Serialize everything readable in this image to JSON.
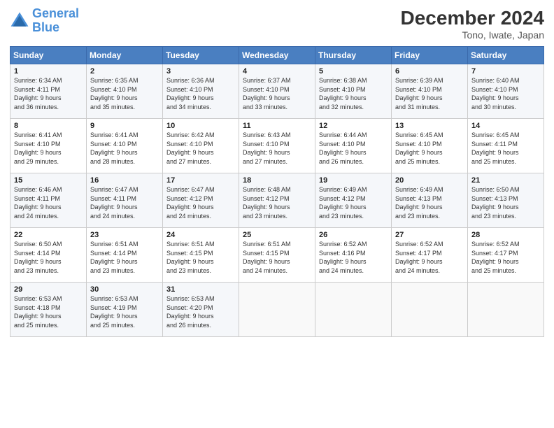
{
  "header": {
    "logo_line1": "General",
    "logo_line2": "Blue",
    "month": "December 2024",
    "location": "Tono, Iwate, Japan"
  },
  "weekdays": [
    "Sunday",
    "Monday",
    "Tuesday",
    "Wednesday",
    "Thursday",
    "Friday",
    "Saturday"
  ],
  "weeks": [
    [
      {
        "day": "1",
        "lines": [
          "Sunrise: 6:34 AM",
          "Sunset: 4:11 PM",
          "Daylight: 9 hours",
          "and 36 minutes."
        ]
      },
      {
        "day": "2",
        "lines": [
          "Sunrise: 6:35 AM",
          "Sunset: 4:10 PM",
          "Daylight: 9 hours",
          "and 35 minutes."
        ]
      },
      {
        "day": "3",
        "lines": [
          "Sunrise: 6:36 AM",
          "Sunset: 4:10 PM",
          "Daylight: 9 hours",
          "and 34 minutes."
        ]
      },
      {
        "day": "4",
        "lines": [
          "Sunrise: 6:37 AM",
          "Sunset: 4:10 PM",
          "Daylight: 9 hours",
          "and 33 minutes."
        ]
      },
      {
        "day": "5",
        "lines": [
          "Sunrise: 6:38 AM",
          "Sunset: 4:10 PM",
          "Daylight: 9 hours",
          "and 32 minutes."
        ]
      },
      {
        "day": "6",
        "lines": [
          "Sunrise: 6:39 AM",
          "Sunset: 4:10 PM",
          "Daylight: 9 hours",
          "and 31 minutes."
        ]
      },
      {
        "day": "7",
        "lines": [
          "Sunrise: 6:40 AM",
          "Sunset: 4:10 PM",
          "Daylight: 9 hours",
          "and 30 minutes."
        ]
      }
    ],
    [
      {
        "day": "8",
        "lines": [
          "Sunrise: 6:41 AM",
          "Sunset: 4:10 PM",
          "Daylight: 9 hours",
          "and 29 minutes."
        ]
      },
      {
        "day": "9",
        "lines": [
          "Sunrise: 6:41 AM",
          "Sunset: 4:10 PM",
          "Daylight: 9 hours",
          "and 28 minutes."
        ]
      },
      {
        "day": "10",
        "lines": [
          "Sunrise: 6:42 AM",
          "Sunset: 4:10 PM",
          "Daylight: 9 hours",
          "and 27 minutes."
        ]
      },
      {
        "day": "11",
        "lines": [
          "Sunrise: 6:43 AM",
          "Sunset: 4:10 PM",
          "Daylight: 9 hours",
          "and 27 minutes."
        ]
      },
      {
        "day": "12",
        "lines": [
          "Sunrise: 6:44 AM",
          "Sunset: 4:10 PM",
          "Daylight: 9 hours",
          "and 26 minutes."
        ]
      },
      {
        "day": "13",
        "lines": [
          "Sunrise: 6:45 AM",
          "Sunset: 4:10 PM",
          "Daylight: 9 hours",
          "and 25 minutes."
        ]
      },
      {
        "day": "14",
        "lines": [
          "Sunrise: 6:45 AM",
          "Sunset: 4:11 PM",
          "Daylight: 9 hours",
          "and 25 minutes."
        ]
      }
    ],
    [
      {
        "day": "15",
        "lines": [
          "Sunrise: 6:46 AM",
          "Sunset: 4:11 PM",
          "Daylight: 9 hours",
          "and 24 minutes."
        ]
      },
      {
        "day": "16",
        "lines": [
          "Sunrise: 6:47 AM",
          "Sunset: 4:11 PM",
          "Daylight: 9 hours",
          "and 24 minutes."
        ]
      },
      {
        "day": "17",
        "lines": [
          "Sunrise: 6:47 AM",
          "Sunset: 4:12 PM",
          "Daylight: 9 hours",
          "and 24 minutes."
        ]
      },
      {
        "day": "18",
        "lines": [
          "Sunrise: 6:48 AM",
          "Sunset: 4:12 PM",
          "Daylight: 9 hours",
          "and 23 minutes."
        ]
      },
      {
        "day": "19",
        "lines": [
          "Sunrise: 6:49 AM",
          "Sunset: 4:12 PM",
          "Daylight: 9 hours",
          "and 23 minutes."
        ]
      },
      {
        "day": "20",
        "lines": [
          "Sunrise: 6:49 AM",
          "Sunset: 4:13 PM",
          "Daylight: 9 hours",
          "and 23 minutes."
        ]
      },
      {
        "day": "21",
        "lines": [
          "Sunrise: 6:50 AM",
          "Sunset: 4:13 PM",
          "Daylight: 9 hours",
          "and 23 minutes."
        ]
      }
    ],
    [
      {
        "day": "22",
        "lines": [
          "Sunrise: 6:50 AM",
          "Sunset: 4:14 PM",
          "Daylight: 9 hours",
          "and 23 minutes."
        ]
      },
      {
        "day": "23",
        "lines": [
          "Sunrise: 6:51 AM",
          "Sunset: 4:14 PM",
          "Daylight: 9 hours",
          "and 23 minutes."
        ]
      },
      {
        "day": "24",
        "lines": [
          "Sunrise: 6:51 AM",
          "Sunset: 4:15 PM",
          "Daylight: 9 hours",
          "and 23 minutes."
        ]
      },
      {
        "day": "25",
        "lines": [
          "Sunrise: 6:51 AM",
          "Sunset: 4:15 PM",
          "Daylight: 9 hours",
          "and 24 minutes."
        ]
      },
      {
        "day": "26",
        "lines": [
          "Sunrise: 6:52 AM",
          "Sunset: 4:16 PM",
          "Daylight: 9 hours",
          "and 24 minutes."
        ]
      },
      {
        "day": "27",
        "lines": [
          "Sunrise: 6:52 AM",
          "Sunset: 4:17 PM",
          "Daylight: 9 hours",
          "and 24 minutes."
        ]
      },
      {
        "day": "28",
        "lines": [
          "Sunrise: 6:52 AM",
          "Sunset: 4:17 PM",
          "Daylight: 9 hours",
          "and 25 minutes."
        ]
      }
    ],
    [
      {
        "day": "29",
        "lines": [
          "Sunrise: 6:53 AM",
          "Sunset: 4:18 PM",
          "Daylight: 9 hours",
          "and 25 minutes."
        ]
      },
      {
        "day": "30",
        "lines": [
          "Sunrise: 6:53 AM",
          "Sunset: 4:19 PM",
          "Daylight: 9 hours",
          "and 25 minutes."
        ]
      },
      {
        "day": "31",
        "lines": [
          "Sunrise: 6:53 AM",
          "Sunset: 4:20 PM",
          "Daylight: 9 hours",
          "and 26 minutes."
        ]
      },
      null,
      null,
      null,
      null
    ]
  ]
}
